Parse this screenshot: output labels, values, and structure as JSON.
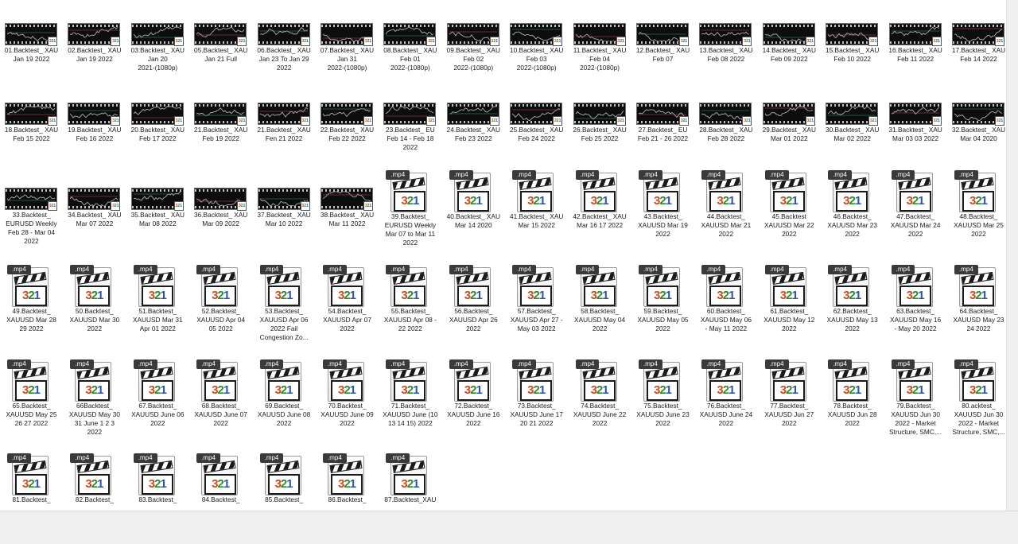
{
  "window": {
    "title": ""
  },
  "file_extension_label": ".mp4",
  "thumb_badge": [
    "3",
    "2",
    "1"
  ],
  "clapper_digits": [
    "3",
    "2",
    "1"
  ],
  "rows": [
    {
      "items": [
        {
          "type": "video",
          "name": "01.Backtest_ XAU\nJan 19 2022"
        },
        {
          "type": "video",
          "name": "02.Backtest_ XAU\nJan 19 2022"
        },
        {
          "type": "video",
          "name": "03.Backtest_ XAU\nJan 20\n2021-(1080p)"
        },
        {
          "type": "video",
          "name": "05.Backtest_ XAU\nJan 21 Full"
        },
        {
          "type": "video",
          "name": "06.Backtest_ XAU\nJan 23 To Jan 29\n2022"
        },
        {
          "type": "video",
          "name": "07.Backtest_ XAU\nJan 31\n2022-(1080p)"
        },
        {
          "type": "video",
          "name": "08.Backtest_ XAU\nFeb 01\n2022-(1080p)"
        },
        {
          "type": "video",
          "name": "09.Backtest_ XAU\nFeb 02\n2022-(1080p)"
        },
        {
          "type": "video",
          "name": "10.Backtest_ XAU\nFeb 03\n2022-(1080p)"
        },
        {
          "type": "video",
          "name": "11.Backtest_ XAU\nFeb 04\n2022-(1080p)"
        },
        {
          "type": "video",
          "name": "12.Backtest_ XAU\nFeb 07"
        },
        {
          "type": "video",
          "name": "13.Backtest_ XAU\nFeb 08 2022"
        },
        {
          "type": "video",
          "name": "14.Backtest_ XAU\nFeb 09 2022"
        },
        {
          "type": "video",
          "name": "15.Backtest_ XAU\nFeb 10 2022"
        },
        {
          "type": "video",
          "name": "16.Backtest_ XAU\nFeb 11 2022"
        },
        {
          "type": "video",
          "name": "17.Backtest_ XAU\nFeb 14 2022"
        }
      ]
    },
    {
      "items": [
        {
          "type": "video",
          "name": "18.Backtest_ XAU\nFeb 15 2022"
        },
        {
          "type": "video",
          "name": "19.Backtest_ XAU\nFeb 16 2022"
        },
        {
          "type": "video",
          "name": "20.Backtest_ XAU\nFeb 17 2022"
        },
        {
          "type": "video",
          "name": "21.Backtest_ XAU\nFeb 19 2022"
        },
        {
          "type": "video",
          "name": "21.Backtest_ XAU\nFen 21 2022"
        },
        {
          "type": "video",
          "name": "22.Backtest_ XAU\nFeb 22 2022"
        },
        {
          "type": "video",
          "name": "23.Backtest_ EU\nFeb 14 - Feb 18\n2022"
        },
        {
          "type": "video",
          "name": "24.Backtest_ XAU\nFeb 23 2022"
        },
        {
          "type": "video",
          "name": "25.Backtest_ XAU\nFeb 24 2022"
        },
        {
          "type": "video",
          "name": "26.Backtest_ XAU\nFeb 25 2022"
        },
        {
          "type": "video",
          "name": "27.Backtest_ EU\nFeb 21 - 26 2022"
        },
        {
          "type": "video",
          "name": "28.Backtest_ XAU\nFeb 28 2022"
        },
        {
          "type": "video",
          "name": "29.Backtest_ XAU\nMar 01 2022"
        },
        {
          "type": "video",
          "name": "30.Backtest_ XAU\nMar 02 2022"
        },
        {
          "type": "video",
          "name": "31.Backtest_ XAU\nMar 03 03 2022"
        },
        {
          "type": "video",
          "name": "32.Backtest_ XAU\nMar 04 2020"
        }
      ]
    },
    {
      "items": [
        {
          "type": "video",
          "name": "33.Backtest_\nEURUSD Weekly\nFeb 28 - Mar 04\n2022"
        },
        {
          "type": "video",
          "name": "34.Backtest_ XAU\nMar 07 2022"
        },
        {
          "type": "video",
          "name": "35.Backtest_ XAU\nMar 08 2022"
        },
        {
          "type": "video",
          "name": "36.Backtest_ XAU\nMar 09 2022"
        },
        {
          "type": "video",
          "name": "37.Backtest_ XAU\nMar 10 2022"
        },
        {
          "type": "video",
          "name": "38.Backtest_ XAU\nMar 11 2022"
        },
        {
          "type": "file",
          "name": "39.Backtest_\nEURUSD Weekly\nMar 07 to Mar 11\n2022"
        },
        {
          "type": "file",
          "name": "40.Backtest_ XAU\nMar 14 2020"
        },
        {
          "type": "file",
          "name": "41.Backtest_ XAU\nMar 15 2022"
        },
        {
          "type": "file",
          "name": "42.Backtest_ XAU\nMar 16   17 2022"
        },
        {
          "type": "file",
          "name": "43.Backtest_\nXAUUSD Mar 19\n2022"
        },
        {
          "type": "file",
          "name": "44.Backtest_\nXAUUSD Mar 21\n2022"
        },
        {
          "type": "file",
          "name": "45.Backtest\nXAUUSD Mar 22\n2022"
        },
        {
          "type": "file",
          "name": "46.Backtest_\nXAUUSD Mar 23\n2022"
        },
        {
          "type": "file",
          "name": "47.Backtest_\nXAUUSD Mar 24\n2022"
        },
        {
          "type": "file",
          "name": "48.Backtest_\nXAUUSD Mar 25\n2022"
        }
      ]
    },
    {
      "items": [
        {
          "type": "file",
          "name": "49.Backtest_\nXAUUSD Mar 28\n29 2022"
        },
        {
          "type": "file",
          "name": "50.Backtest_\nXAUUSD Mar 30\n2022"
        },
        {
          "type": "file",
          "name": "51.Backtest_\nXAUUSD Mar 31\nApr 01 2022"
        },
        {
          "type": "file",
          "name": "52.Backtest_\nXAUUSD Apr 04\n05 2022"
        },
        {
          "type": "file",
          "name": "53.Backtest_\nXAUUSD Apr 06\n2022   Fail\nCongestion Zo..."
        },
        {
          "type": "file",
          "name": "54.Backtest_\nXAUUSD Apr 07\n2022"
        },
        {
          "type": "file",
          "name": "55.Backtest_\nXAUUSD Apr 08 -\n22 2022"
        },
        {
          "type": "file",
          "name": "56.Backtest_\nXAUUSD Apr 26\n2022"
        },
        {
          "type": "file",
          "name": "57.Backtest_\nXAUUSD Apr 27 -\nMay 03 2022"
        },
        {
          "type": "file",
          "name": "58.Backtest_\nXAUUSD May 04\n2022"
        },
        {
          "type": "file",
          "name": "59.Backtest_\nXAUUSD May 05\n2022"
        },
        {
          "type": "file",
          "name": "60.Backtest_\nXAUUSD May 06\n- May 11 2022"
        },
        {
          "type": "file",
          "name": "61.Backtest_\nXAUUSD May 12\n2022"
        },
        {
          "type": "file",
          "name": "62.Backtest_\nXAUUSD May 13\n2022"
        },
        {
          "type": "file",
          "name": "63.Backtest_\nXAUUSD May 16\n- May 20 2022"
        },
        {
          "type": "file",
          "name": "64.Backtest_\nXAUUSD May 23\n24 2022"
        }
      ]
    },
    {
      "items": [
        {
          "type": "file",
          "name": "65.Backtest_\nXAUUSD May 25\n26  27 2022"
        },
        {
          "type": "file",
          "name": "66Backtest_\nXAUUSD May 30\n31   June 1   2   3\n2022"
        },
        {
          "type": "file",
          "name": "67.Backtest_\nXAUUSD June 06\n2022"
        },
        {
          "type": "file",
          "name": "68.Backtest_\nXAUUSD June 07\n2022"
        },
        {
          "type": "file",
          "name": "69.Backtest_\nXAUUSD June 08\n2022"
        },
        {
          "type": "file",
          "name": "70.Backtest_\nXAUUSD June 09\n2022"
        },
        {
          "type": "file",
          "name": "71.Backtest_\nXAUUSD June (10\n13   14   15) 2022"
        },
        {
          "type": "file",
          "name": "72.Backtest_\nXAUUSD June 16\n2022"
        },
        {
          "type": "file",
          "name": "73.Backtest_\nXAUUSD June 17\n20   21 2022"
        },
        {
          "type": "file",
          "name": "74.Backtest_\nXAUUSD June 22\n2022"
        },
        {
          "type": "file",
          "name": "75.Backtest_\nXAUUSD June 23\n2022"
        },
        {
          "type": "file",
          "name": "76.Backtest_\nXAUUSD June 24\n2022"
        },
        {
          "type": "file",
          "name": "77.Backtest_\nXAUUSD Jun 27\n2022"
        },
        {
          "type": "file",
          "name": "78.Backtest_\nXAUUSD Jun 28\n2022"
        },
        {
          "type": "file",
          "name": "79.Backtest_\nXAUUSD Jun 30\n2022 - Market\nStructure, SMC,..."
        },
        {
          "type": "file",
          "name": "80.acktest_\nXAUUSD Jun 30\n2022 - Market\nStructure, SMC,..."
        }
      ]
    },
    {
      "items": [
        {
          "type": "file",
          "name": "81.Backtest_"
        },
        {
          "type": "file",
          "name": "82.Backtest_"
        },
        {
          "type": "file",
          "name": "83.Backtest_"
        },
        {
          "type": "file",
          "name": "84.Backtest_"
        },
        {
          "type": "file",
          "name": "85.Backtest_"
        },
        {
          "type": "file",
          "name": "86.Backtest_"
        },
        {
          "type": "file",
          "name": "87.Backtest_XAU"
        }
      ]
    }
  ]
}
